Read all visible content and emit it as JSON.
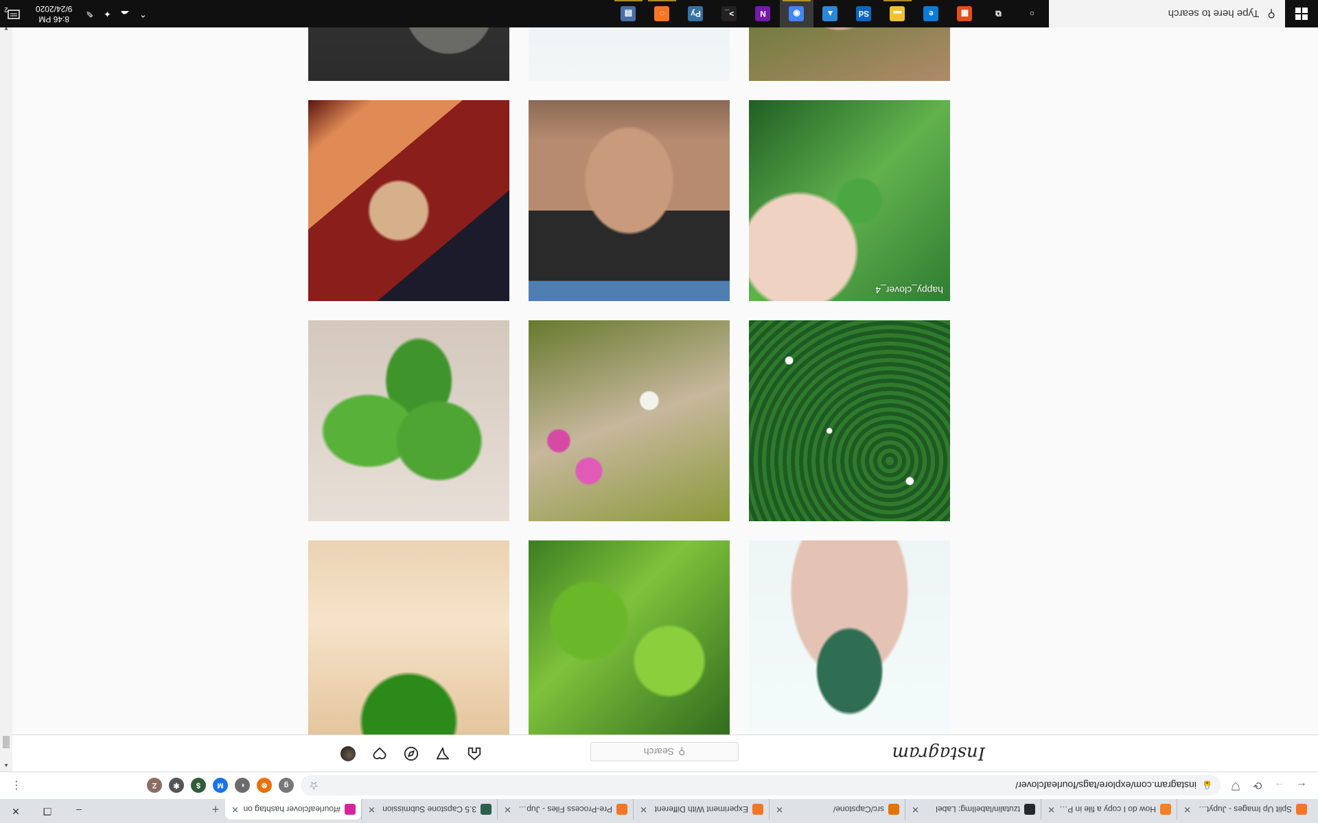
{
  "browser": {
    "tabs": [
      {
        "title": "Split Up Images - Jupyter N",
        "favicon_color": "#f37626",
        "active": false
      },
      {
        "title": "How do I copy a file in Pyth",
        "favicon_color": "#f48024",
        "active": false
      },
      {
        "title": "tzutalin/labelImg: Label",
        "favicon_color": "#24292e",
        "active": false
      },
      {
        "title": "src/Capstone/",
        "favicon_color": "#e37400",
        "active": false
      },
      {
        "title": "Experiment With Different",
        "favicon_color": "#f37626",
        "active": false
      },
      {
        "title": "Pre-Process Files - Jupyter",
        "favicon_color": "#f37626",
        "active": false
      },
      {
        "title": "3.5 Capstone Submission",
        "favicon_color": "#2e5e4e",
        "active": false
      },
      {
        "title": "#fourleafclover hashtag on",
        "favicon_color": "#d6249f",
        "active": true
      }
    ],
    "new_tab": "+",
    "window_buttons": [
      "–",
      "❐",
      "✕"
    ],
    "url": "instagram.com/explore/tags/fourleafclover/",
    "extensions": [
      {
        "name": "g",
        "color": "#777777"
      },
      {
        "name": "⊗",
        "color": "#e8710a"
      },
      {
        "name": "◐",
        "color": "#6c6c6c"
      },
      {
        "name": "M",
        "color": "#1a73e8"
      },
      {
        "name": "$",
        "color": "#2f5e3a"
      },
      {
        "name": "✱",
        "color": "#555555"
      },
      {
        "name": "Z",
        "color": "#8d6e63"
      }
    ]
  },
  "instagram": {
    "logo": "Instagram",
    "search_placeholder": "Search"
  },
  "grid": {
    "tiles": [
      {
        "name": "clover-in-hand-top",
        "row": 0,
        "col": 0,
        "caption": ""
      },
      {
        "name": "clover-leaves-top",
        "row": 0,
        "col": 1,
        "caption": ""
      },
      {
        "name": "clover-sand-top",
        "row": 0,
        "col": 2,
        "caption": ""
      },
      {
        "name": "clover-field",
        "row": 1,
        "col": 0,
        "caption": ""
      },
      {
        "name": "clover-flowers",
        "row": 1,
        "col": 1,
        "caption": ""
      },
      {
        "name": "four-leaf-closeup",
        "row": 1,
        "col": 2,
        "caption": ""
      },
      {
        "name": "hand-picking-clover",
        "row": 2,
        "col": 0,
        "caption": "happy_clover_4"
      },
      {
        "name": "person-photo",
        "row": 2,
        "col": 1,
        "caption": ""
      },
      {
        "name": "anime-art",
        "row": 2,
        "col": 2,
        "caption": ""
      },
      {
        "name": "fingers-holding-clover",
        "row": 3,
        "col": 0,
        "caption": ""
      },
      {
        "name": "watercolor-drawing",
        "row": 3,
        "col": 1,
        "caption": ""
      },
      {
        "name": "pressed-flower-coasters",
        "row": 3,
        "col": 2,
        "caption": ""
      }
    ]
  },
  "taskbar": {
    "search_placeholder": "Type here to search",
    "apps": [
      {
        "name": "cortana-icon",
        "glyph": "○",
        "color": "#101010"
      },
      {
        "name": "task-view-icon",
        "glyph": "⧉",
        "color": "#101010"
      },
      {
        "name": "office-icon",
        "glyph": "▦",
        "color": "#e74c1c"
      },
      {
        "name": "edge-icon",
        "glyph": "e",
        "color": "#0c7bd8"
      },
      {
        "name": "file-explorer-icon",
        "glyph": "▬",
        "color": "#f2c12e"
      },
      {
        "name": "photoshop-icon",
        "glyph": "Sd",
        "color": "#0a66c2"
      },
      {
        "name": "photos-icon",
        "glyph": "▲",
        "color": "#2b88d8"
      },
      {
        "name": "chrome-icon",
        "glyph": "◉",
        "color": "#4285f4"
      },
      {
        "name": "onenote-icon",
        "glyph": "N",
        "color": "#7719aa"
      },
      {
        "name": "terminal-icon",
        "glyph": ">_",
        "color": "#222222"
      },
      {
        "name": "python-icon",
        "glyph": "Py",
        "color": "#3672a4"
      },
      {
        "name": "jupyter-icon",
        "glyph": "◌",
        "color": "#f37626"
      },
      {
        "name": "calculator-icon",
        "glyph": "▤",
        "color": "#4a6fa5"
      }
    ],
    "time": "8:46 PM",
    "date": "9/24/2020",
    "notification_count": "2"
  }
}
